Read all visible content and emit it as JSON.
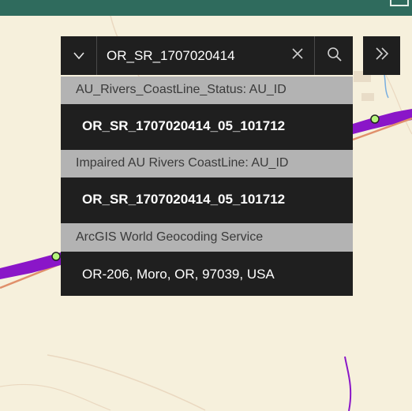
{
  "search": {
    "value": "OR_SR_1707020414",
    "source_icon": "caret-down-icon",
    "clear_icon": "close-icon",
    "search_icon": "search-icon",
    "expand_icon": "double-chevron-right-icon"
  },
  "suggestions": {
    "groups": [
      {
        "header": "AU_Rivers_CoastLine_Status: AU_ID",
        "items": [
          "OR_SR_1707020414_05_101712"
        ]
      },
      {
        "header": "Impaired AU Rivers CoastLine: AU_ID",
        "items": [
          "OR_SR_1707020414_05_101712"
        ]
      },
      {
        "header": "ArcGIS World Geocoding Service",
        "items": [
          "OR-206, Moro, OR, 97039, USA"
        ]
      }
    ]
  },
  "colors": {
    "panel_dark": "#1f1f1f",
    "header_gray": "#b3b3b3",
    "river_purple": "#8a16c8",
    "marker_green": "#b6f57c",
    "topbar": "#2f6b5d"
  }
}
